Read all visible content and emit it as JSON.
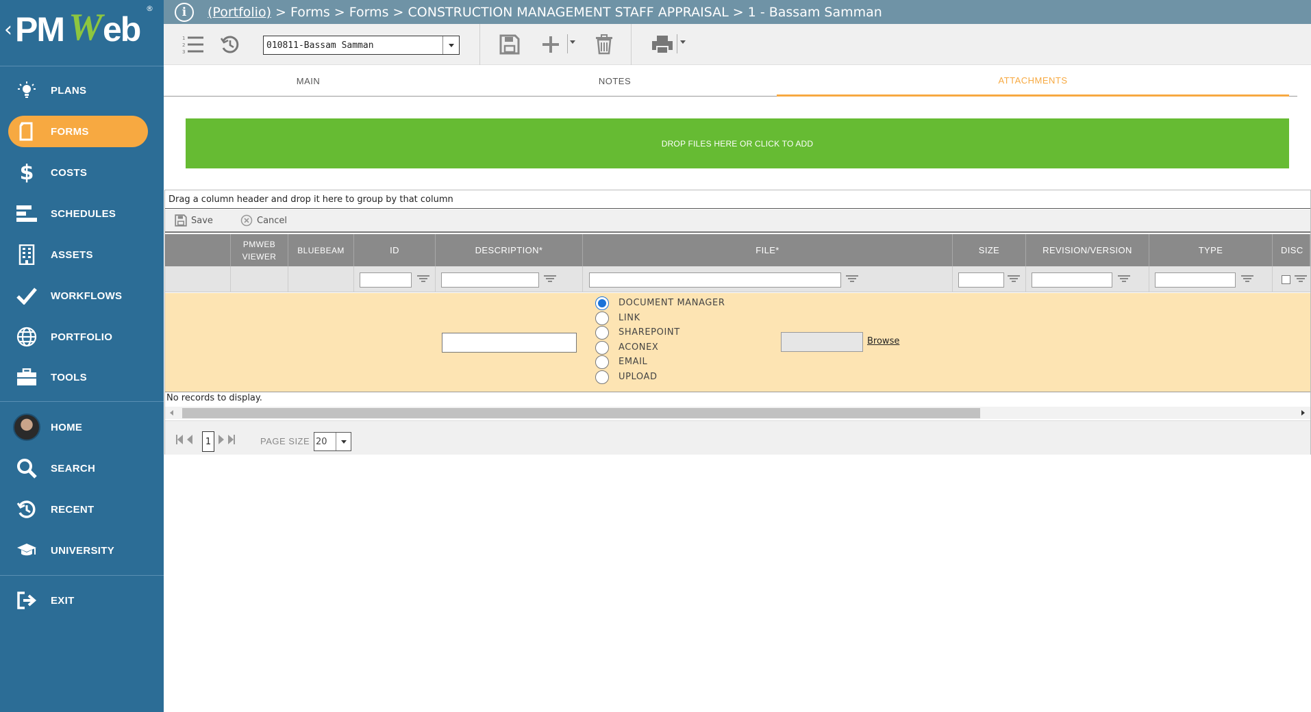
{
  "app": {
    "logo_pm": "PM",
    "logo_w": "W",
    "logo_eb": "eb",
    "logo_reg": "®"
  },
  "breadcrumb": {
    "link": "(Portfolio)",
    "rest": " > Forms > Forms > CONSTRUCTION MANAGEMENT STAFF APPRAISAL > 1 - Bassam Samman"
  },
  "sidebar": {
    "items": [
      {
        "label": "PLANS",
        "icon": "lightbulb-icon"
      },
      {
        "label": "FORMS",
        "icon": "document-icon",
        "active": true
      },
      {
        "label": "COSTS",
        "icon": "dollar-icon"
      },
      {
        "label": "SCHEDULES",
        "icon": "gantt-icon"
      },
      {
        "label": "ASSETS",
        "icon": "building-icon"
      },
      {
        "label": "WORKFLOWS",
        "icon": "checkmark-icon"
      },
      {
        "label": "PORTFOLIO",
        "icon": "globe-icon"
      },
      {
        "label": "TOOLS",
        "icon": "toolbox-icon"
      }
    ],
    "secondary": [
      {
        "label": "HOME",
        "icon": "avatar"
      },
      {
        "label": "SEARCH",
        "icon": "search-icon"
      },
      {
        "label": "RECENT",
        "icon": "history-icon"
      },
      {
        "label": "UNIVERSITY",
        "icon": "graduation-cap-icon"
      }
    ],
    "exit": {
      "label": "EXIT",
      "icon": "exit-icon"
    }
  },
  "toolbar": {
    "record_value": "010811-Bassam Samman"
  },
  "tabs": [
    {
      "label": "MAIN"
    },
    {
      "label": "NOTES"
    },
    {
      "label": "ATTACHMENTS",
      "active": true
    }
  ],
  "dropzone": {
    "label": "DROP FILES HERE OR CLICK TO ADD"
  },
  "grid": {
    "group_hint": "Drag a column header and drop it here to group by that column",
    "save_label": "Save",
    "cancel_label": "Cancel",
    "columns": {
      "pmweb_viewer_1": "PMWEB",
      "pmweb_viewer_2": "VIEWER",
      "bluebeam": "BLUEBEAM",
      "id": "ID",
      "description": "DESCRIPTION*",
      "file": "FILE*",
      "size": "SIZE",
      "revision": "REVISION/VERSION",
      "type": "TYPE",
      "disc": "DISC"
    },
    "file_source_options": [
      {
        "label": "DOCUMENT MANAGER",
        "selected": true
      },
      {
        "label": "LINK"
      },
      {
        "label": "SHAREPOINT"
      },
      {
        "label": "ACONEX"
      },
      {
        "label": "EMAIL"
      },
      {
        "label": "UPLOAD"
      }
    ],
    "browse_label": "Browse",
    "empty_text": "No records to display."
  },
  "pager": {
    "current_page": "1",
    "page_size_label": "PAGE SIZE",
    "page_size_value": "20"
  },
  "colors": {
    "sidebar": "#2c6d96",
    "accent": "#f7a941",
    "dropzone": "#66bb33",
    "header": "#8a8a8a",
    "edit_row": "#fde4b3"
  }
}
